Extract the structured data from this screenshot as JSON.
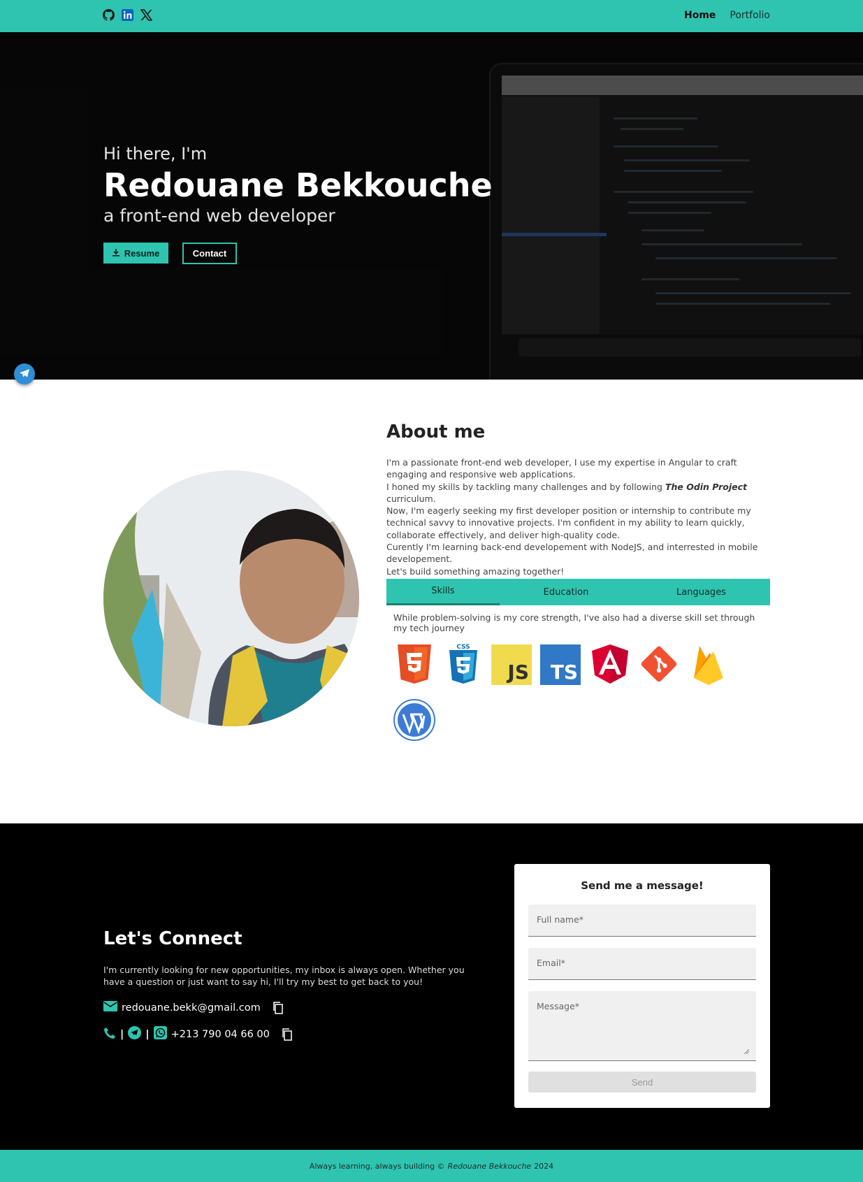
{
  "nav": {
    "socials": [
      "github-icon",
      "linkedin-icon",
      "x-icon"
    ],
    "links": [
      {
        "label": "Home",
        "active": true
      },
      {
        "label": "Portfolio",
        "active": false
      }
    ]
  },
  "hero": {
    "greeting": "Hi there, I'm",
    "name": "Redouane Bekkouche",
    "role": "a front-end web developer",
    "resume_label": "Resume",
    "contact_label": "Contact"
  },
  "about": {
    "title": "About me",
    "line1": "I'm a passionate front-end web developer, I use my expertise in Angular to craft engaging and responsive web applications.",
    "line2_pre": "I honed my skills by tackling many challenges and by following ",
    "line2_em": "The Odin Project",
    "line2_post": " curriculum.",
    "line3": "Now, I'm eagerly seeking my first developer position or internship to contribute my technical savvy to innovative projects. I'm confident in my ability to learn quickly, collaborate effectively, and deliver high-quality code.",
    "line4": "Curently I'm learning back-end developement with NodeJS, and interrested in mobile developement.",
    "line5": "Let's build something amazing together!",
    "tabs": [
      "Skills",
      "Education",
      "Languages"
    ],
    "skills_desc": "While problem-solving is my core strength, I've also had a diverse skill set through my tech journey",
    "skill_icons": [
      "html5-icon",
      "css3-icon",
      "javascript-icon",
      "typescript-icon",
      "angular-icon",
      "git-icon",
      "firebase-icon",
      "wordpress-icon"
    ],
    "skill_texts": {
      "js": "JS",
      "ts": "TS",
      "css": "CSS"
    }
  },
  "connect": {
    "title": "Let's Connect",
    "intro": "I'm currently looking for new opportunities, my inbox is always open. Whether you have a question or just want to say hi, I'll try my best to get back to you!",
    "email": "redouane.bekk@gmail.com",
    "phone": "+213 790 04 66 00",
    "separator": "|",
    "form": {
      "title": "Send me a message!",
      "fullname_placeholder": "Full name*",
      "email_placeholder": "Email*",
      "message_placeholder": "Message*",
      "send_label": "Send"
    }
  },
  "footer": {
    "text_pre": "Always learning, always building © ",
    "name": "Redouane Bekkouche",
    "year": "2024"
  },
  "colors": {
    "accent": "#2ec4b0",
    "dark": "#000000"
  }
}
